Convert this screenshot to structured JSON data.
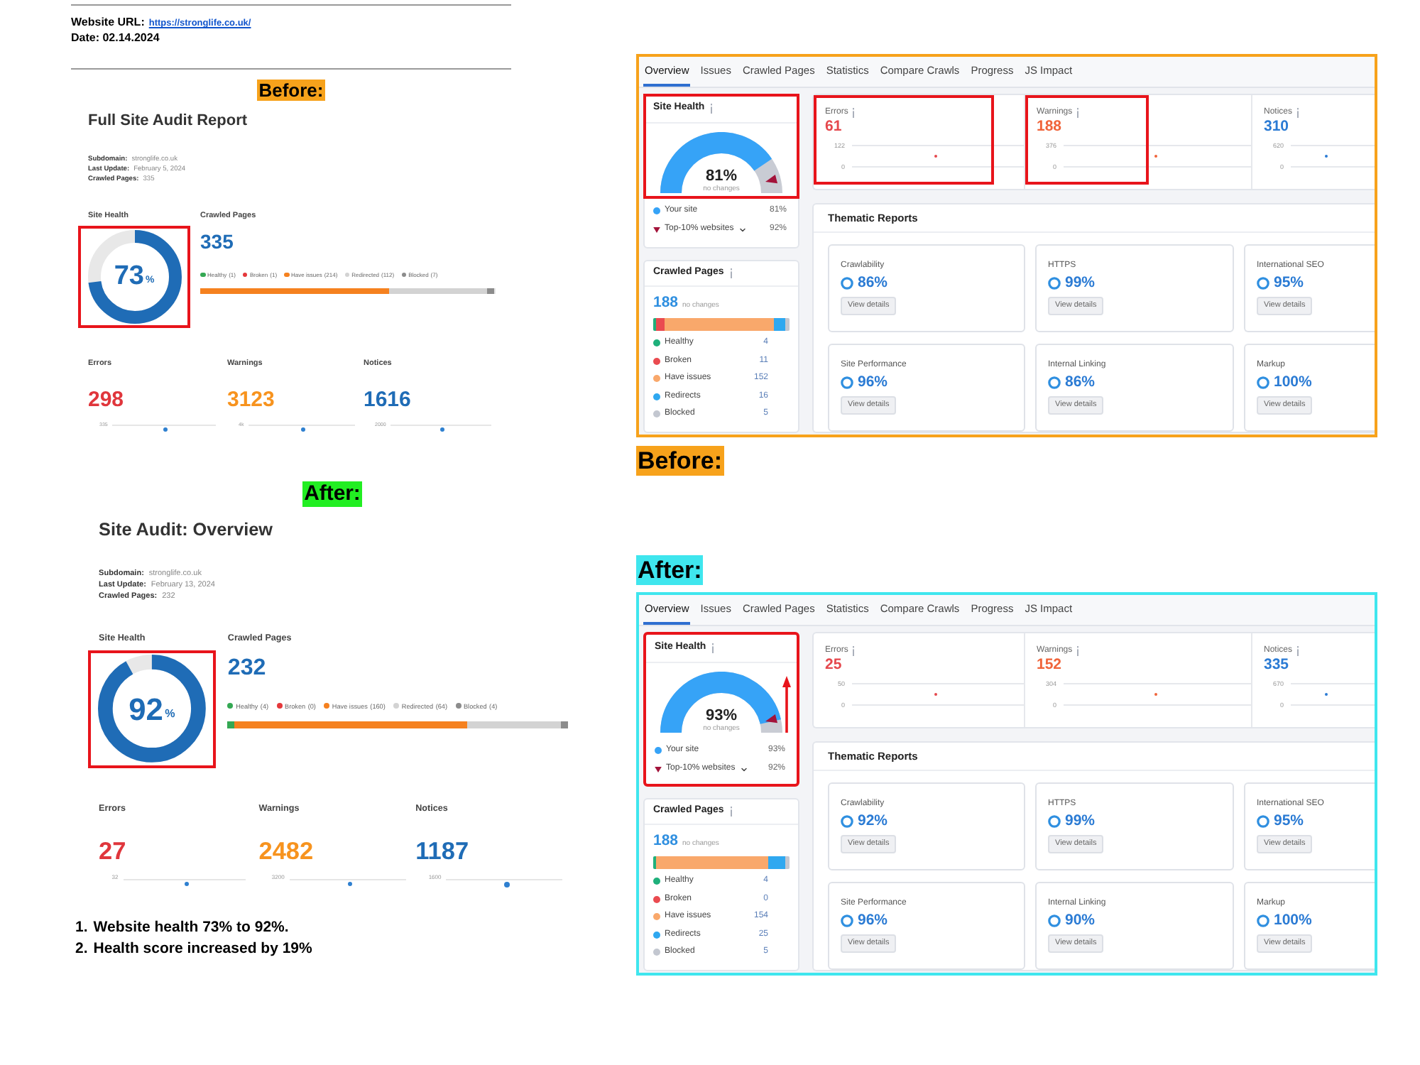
{
  "document": {
    "url_label": "Website URL:",
    "url": "https://stronglife.co.uk/",
    "date": "Date: 02.14.2024"
  },
  "reports": [
    {
      "tag": "Before:",
      "color": "#f7a21b",
      "title": "Full Site Audit Report",
      "meta": [
        {
          "label": "Subdomain:",
          "value": "stronglife.co.uk"
        },
        {
          "label": "Last Update:",
          "value": "February 5, 2024"
        },
        {
          "label": "Crawled Pages:",
          "value": "335"
        }
      ],
      "site_health": {
        "label": "Site Health",
        "value": "73",
        "unit": "%",
        "highlighted": true
      },
      "crawled_pages": {
        "label": "Crawled Pages",
        "value": "335",
        "legend": [
          {
            "label": "Healthy",
            "count": "(1)",
            "color": "#34a853"
          },
          {
            "label": "Broken",
            "count": "(1)",
            "color": "#e5383b"
          },
          {
            "label": "Have issues",
            "count": "(214)",
            "color": "#f5811f"
          },
          {
            "label": "Redirected",
            "count": "(112)",
            "color": "#d3d3d3"
          },
          {
            "label": "Blocked",
            "count": "(7)",
            "color": "#8c8c8c"
          }
        ]
      },
      "metrics": [
        {
          "label": "Errors",
          "value": "298",
          "color": "#e0363c",
          "axis_label": "335"
        },
        {
          "label": "Warnings",
          "value": "3123",
          "color": "#f7931e",
          "axis_label": "4k"
        },
        {
          "label": "Notices",
          "value": "1616",
          "color": "#1f6cb6",
          "axis_label": "2000"
        }
      ]
    },
    {
      "tag": "After:",
      "color": "#22ee22",
      "title": "Site Audit: Overview",
      "meta": [
        {
          "label": "Subdomain:",
          "value": "stronglife.co.uk"
        },
        {
          "label": "Last Update:",
          "value": "February 13, 2024"
        },
        {
          "label": "Crawled Pages:",
          "value": "232"
        }
      ],
      "site_health": {
        "label": "Site Health",
        "value": "92",
        "unit": "%",
        "highlighted": true
      },
      "crawled_pages": {
        "label": "Crawled Pages",
        "value": "232",
        "legend": [
          {
            "label": "Healthy",
            "count": "(4)",
            "color": "#34a853"
          },
          {
            "label": "Broken",
            "count": "(0)",
            "color": "#e5383b"
          },
          {
            "label": "Have issues",
            "count": "(160)",
            "color": "#f5811f"
          },
          {
            "label": "Redirected",
            "count": "(64)",
            "color": "#d3d3d3"
          },
          {
            "label": "Blocked",
            "count": "(4)",
            "color": "#8c8c8c"
          }
        ]
      },
      "metrics": [
        {
          "label": "Errors",
          "value": "27",
          "color": "#e0363c",
          "axis_label": "32"
        },
        {
          "label": "Warnings",
          "value": "2482",
          "color": "#f7931e",
          "axis_label": "3200"
        },
        {
          "label": "Notices",
          "value": "1187",
          "color": "#1f6cb6",
          "axis_label": "1600"
        }
      ]
    }
  ],
  "notes": [
    {
      "number": "1.",
      "text": "Website health 73% to 92%."
    },
    {
      "number": "2.",
      "text": "Health score increased by 19%"
    }
  ],
  "screenshots": [
    {
      "kind": "panel",
      "color": "#f7a21b",
      "tabs": [
        {
          "label": "Overview",
          "selected": true
        },
        {
          "label": "Issues",
          "selected": false
        },
        {
          "label": "Crawled Pages",
          "selected": false
        },
        {
          "label": "Statistics",
          "selected": false
        },
        {
          "label": "Compare Crawls",
          "selected": false
        },
        {
          "label": "Progress",
          "selected": false
        },
        {
          "label": "JS Impact",
          "selected": false
        }
      ],
      "site_health": {
        "title": "Site Health",
        "value": "81%",
        "note": "no changes",
        "gauge_highlighted": true,
        "highlighted": false,
        "trend_arrow": false,
        "legend": [
          {
            "label": "Your site",
            "value": "81%",
            "kind": "site",
            "color": "#36a3f7"
          },
          {
            "label": "Top-10% websites",
            "value": "92%",
            "kind": "benchmark",
            "color": "#a3133a"
          }
        ]
      },
      "crawled_pages": {
        "title": "Crawled Pages",
        "value": "188",
        "note": "no changes",
        "legend": [
          {
            "label": "Healthy",
            "count": "4",
            "color": "#1fb07b"
          },
          {
            "label": "Broken",
            "count": "11",
            "color": "#ea4b50"
          },
          {
            "label": "Have issues",
            "count": "152",
            "color": "#f9a86b"
          },
          {
            "label": "Redirects",
            "count": "16",
            "color": "#2fa8f0"
          },
          {
            "label": "Blocked",
            "count": "5",
            "color": "#c3c7d0"
          }
        ]
      },
      "metrics": [
        {
          "label": "Errors",
          "value": "61",
          "axis_max": "122",
          "axis_min": "0",
          "color": "#e5484d",
          "highlighted": true
        },
        {
          "label": "Warnings",
          "value": "188",
          "axis_max": "376",
          "axis_min": "0",
          "color": "#f0643a",
          "highlighted": true
        },
        {
          "label": "Notices",
          "value": "310",
          "axis_max": "620",
          "axis_min": "0",
          "color": "#2b7bd4",
          "highlighted": false
        }
      ],
      "thematic_reports": {
        "title": "Thematic Reports",
        "items": [
          {
            "name": "Crawlability",
            "value": "86%",
            "button": "View details"
          },
          {
            "name": "HTTPS",
            "value": "99%",
            "button": "View details"
          },
          {
            "name": "International SEO",
            "value": "95%",
            "button": "View details"
          },
          {
            "name": "Site Performance",
            "value": "96%",
            "button": "View details"
          },
          {
            "name": "Internal Linking",
            "value": "86%",
            "button": "View details"
          },
          {
            "name": "Markup",
            "value": "100%",
            "button": "View details"
          }
        ]
      }
    },
    {
      "kind": "caption",
      "text": "Before:",
      "color": "#f7a21b"
    },
    {
      "kind": "caption",
      "text": "After:",
      "color": "#3fe6ee"
    },
    {
      "kind": "panel",
      "color": "#3fe6ee",
      "tabs": [
        {
          "label": "Overview",
          "selected": true
        },
        {
          "label": "Issues",
          "selected": false
        },
        {
          "label": "Crawled Pages",
          "selected": false
        },
        {
          "label": "Statistics",
          "selected": false
        },
        {
          "label": "Compare Crawls",
          "selected": false
        },
        {
          "label": "Progress",
          "selected": false
        },
        {
          "label": "JS Impact",
          "selected": false
        }
      ],
      "site_health": {
        "title": "Site Health",
        "value": "93%",
        "note": "no changes",
        "gauge_highlighted": false,
        "highlighted": true,
        "trend_arrow": true,
        "legend": [
          {
            "label": "Your site",
            "value": "93%",
            "kind": "site",
            "color": "#36a3f7"
          },
          {
            "label": "Top-10% websites",
            "value": "92%",
            "kind": "benchmark",
            "color": "#a3133a"
          }
        ]
      },
      "crawled_pages": {
        "title": "Crawled Pages",
        "value": "188",
        "note": "no changes",
        "legend": [
          {
            "label": "Healthy",
            "count": "4",
            "color": "#1fb07b"
          },
          {
            "label": "Broken",
            "count": "0",
            "color": "#ea4b50"
          },
          {
            "label": "Have issues",
            "count": "154",
            "color": "#f9a86b"
          },
          {
            "label": "Redirects",
            "count": "25",
            "color": "#2fa8f0"
          },
          {
            "label": "Blocked",
            "count": "5",
            "color": "#c3c7d0"
          }
        ]
      },
      "metrics": [
        {
          "label": "Errors",
          "value": "25",
          "axis_max": "50",
          "axis_min": "0",
          "color": "#e5484d",
          "highlighted": false
        },
        {
          "label": "Warnings",
          "value": "152",
          "axis_max": "304",
          "axis_min": "0",
          "color": "#f0643a",
          "highlighted": false
        },
        {
          "label": "Notices",
          "value": "335",
          "axis_max": "670",
          "axis_min": "0",
          "color": "#2b7bd4",
          "highlighted": false
        }
      ],
      "thematic_reports": {
        "title": "Thematic Reports",
        "items": [
          {
            "name": "Crawlability",
            "value": "92%",
            "button": "View details"
          },
          {
            "name": "HTTPS",
            "value": "99%",
            "button": "View details"
          },
          {
            "name": "International SEO",
            "value": "95%",
            "button": "View details"
          },
          {
            "name": "Site Performance",
            "value": "96%",
            "button": "View details"
          },
          {
            "name": "Internal Linking",
            "value": "90%",
            "button": "View details"
          },
          {
            "name": "Markup",
            "value": "100%",
            "button": "View details"
          }
        ]
      }
    }
  ]
}
